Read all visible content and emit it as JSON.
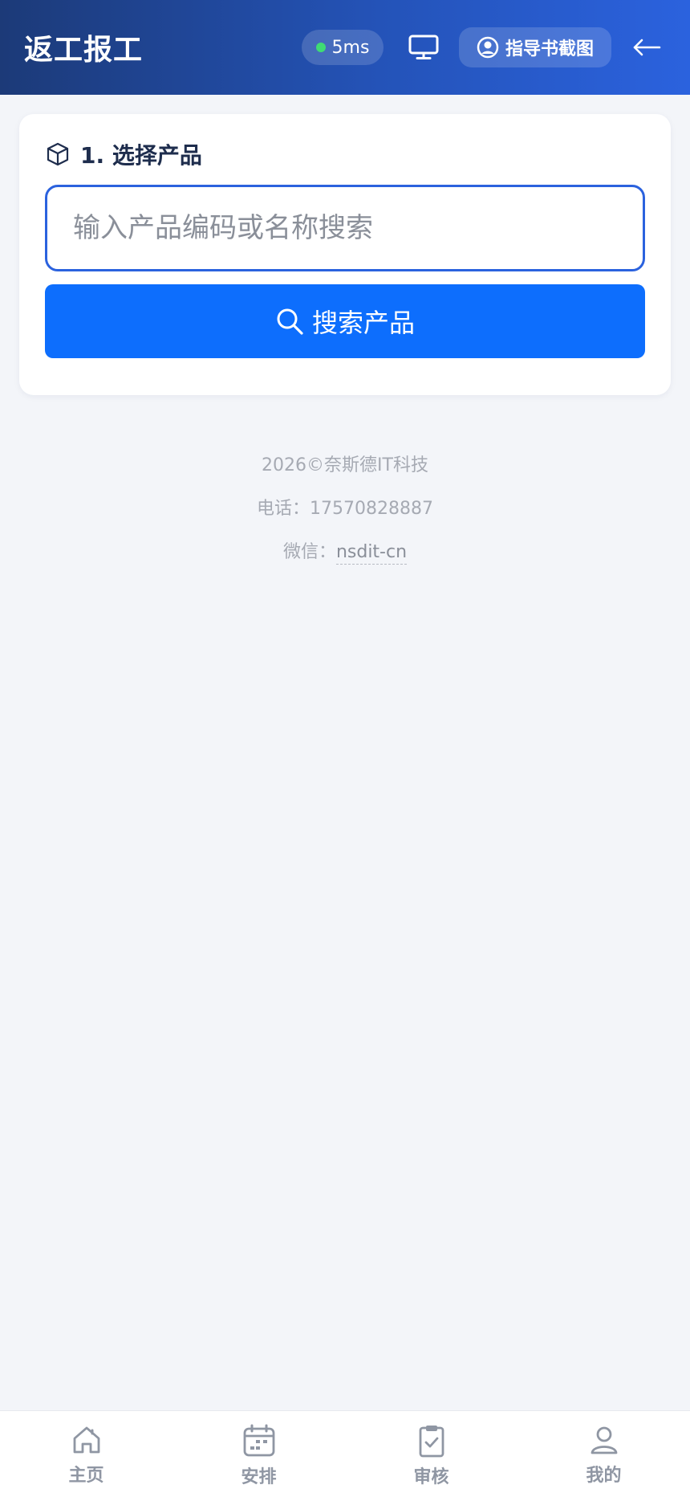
{
  "header": {
    "title": "返工报工",
    "latency": "5ms",
    "guide_label": "指导书截图",
    "icons": {
      "status_dot": "status-dot",
      "monitor": "monitor-icon",
      "guide": "user-circle-icon",
      "back": "arrow-left-icon"
    }
  },
  "step": {
    "title": "1. 选择产品",
    "icon": "box-icon"
  },
  "search": {
    "placeholder": "输入产品编码或名称搜索",
    "value": "",
    "button_label": "搜索产品",
    "button_icon": "search-icon"
  },
  "footer": {
    "copyright": "2026©奈斯德IT科技",
    "phone": "电话：17570828887",
    "wechat_label": "微信：",
    "wechat_id": "nsdit-cn"
  },
  "nav": {
    "items": [
      {
        "label": "主页",
        "icon": "home-icon"
      },
      {
        "label": "安排",
        "icon": "calendar-icon"
      },
      {
        "label": "审核",
        "icon": "clipboard-check-icon"
      },
      {
        "label": "我的",
        "icon": "user-icon"
      }
    ]
  },
  "colors": {
    "header_start": "#1c3a78",
    "header_end": "#2b62de",
    "primary": "#0d6efd",
    "status_ok": "#3fdc74",
    "nav_inactive": "#8f96a3"
  }
}
